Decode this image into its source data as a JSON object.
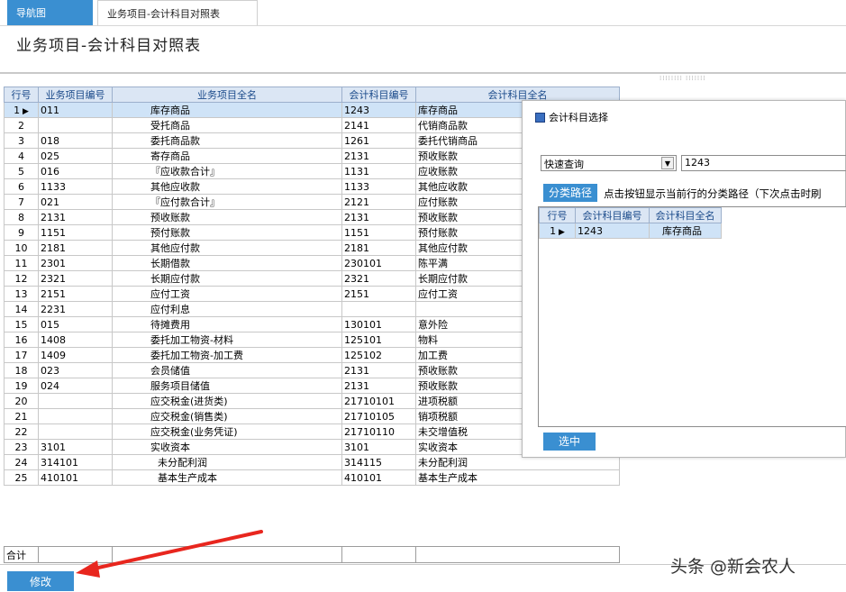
{
  "tabs": {
    "home": "导航图",
    "active": "业务项目-会计科目对照表"
  },
  "page_title": "业务项目-会计科目对照表",
  "grid": {
    "headers": [
      "行号",
      "业务项目编号",
      "业务项目全名",
      "会计科目编号",
      "会计科目全名"
    ],
    "rows": [
      [
        "1",
        "011",
        "库存商品",
        "1243",
        "库存商品"
      ],
      [
        "2",
        "",
        "受托商品",
        "2141",
        "代销商品款"
      ],
      [
        "3",
        "018",
        "委托商品款",
        "1261",
        "委托代销商品"
      ],
      [
        "4",
        "025",
        "寄存商品",
        "2131",
        "预收账款"
      ],
      [
        "5",
        "016",
        "『应收款合计』",
        "1131",
        "应收账款"
      ],
      [
        "6",
        "1133",
        "其他应收款",
        "1133",
        "其他应收款"
      ],
      [
        "7",
        "021",
        "『应付款合计』",
        "2121",
        "应付账款"
      ],
      [
        "8",
        "2131",
        "预收账款",
        "2131",
        "预收账款"
      ],
      [
        "9",
        "1151",
        "预付账款",
        "1151",
        "预付账款"
      ],
      [
        "10",
        "2181",
        "其他应付款",
        "2181",
        "其他应付款"
      ],
      [
        "11",
        "2301",
        "长期借款",
        "230101",
        "陈平满"
      ],
      [
        "12",
        "2321",
        "长期应付款",
        "2321",
        "长期应付款"
      ],
      [
        "13",
        "2151",
        "应付工资",
        "2151",
        "应付工资"
      ],
      [
        "14",
        "2231",
        "应付利息",
        "",
        ""
      ],
      [
        "15",
        "015",
        "待摊费用",
        "130101",
        "意外险"
      ],
      [
        "16",
        "1408",
        "委托加工物资-材料",
        "125101",
        "物料"
      ],
      [
        "17",
        "1409",
        "委托加工物资-加工费",
        "125102",
        "加工费"
      ],
      [
        "18",
        "023",
        "会员储值",
        "2131",
        "预收账款"
      ],
      [
        "19",
        "024",
        "服务项目储值",
        "2131",
        "预收账款"
      ],
      [
        "20",
        "",
        "应交税金(进货类)",
        "21710101",
        "进项税额"
      ],
      [
        "21",
        "",
        "应交税金(销售类)",
        "21710105",
        "销项税额"
      ],
      [
        "22",
        "",
        "应交税金(业务凭证)",
        "21710110",
        "未交增值税"
      ],
      [
        "23",
        "3101",
        "实收资本",
        "3101",
        "实收资本"
      ],
      [
        "24",
        "314101",
        "未分配利润",
        "314115",
        "未分配利润"
      ],
      [
        "25",
        "410101",
        "基本生产成本",
        "410101",
        "基本生产成本"
      ]
    ],
    "indent_rows": [
      23,
      24
    ],
    "selected_row": 0,
    "footer_label": "合计"
  },
  "buttons": {
    "edit": "修改"
  },
  "popup": {
    "title": "会计科目选择",
    "search_mode": "快速查询",
    "search_value": "1243",
    "path_button": "分类路径",
    "path_hint": "点击按钮显示当前行的分类路径（下次点击时刷",
    "headers": [
      "行号",
      "会计科目编号",
      "会计科目全名"
    ],
    "rows": [
      [
        "1",
        "1243",
        "库存商品"
      ]
    ],
    "select_button": "选中"
  },
  "watermark": "头条 @新会农人",
  "colors": {
    "accent": "#3a8fd1",
    "header_bg": "#dbe6f4",
    "selected_bg": "#cfe3f7",
    "annotation": "#e8261e"
  }
}
